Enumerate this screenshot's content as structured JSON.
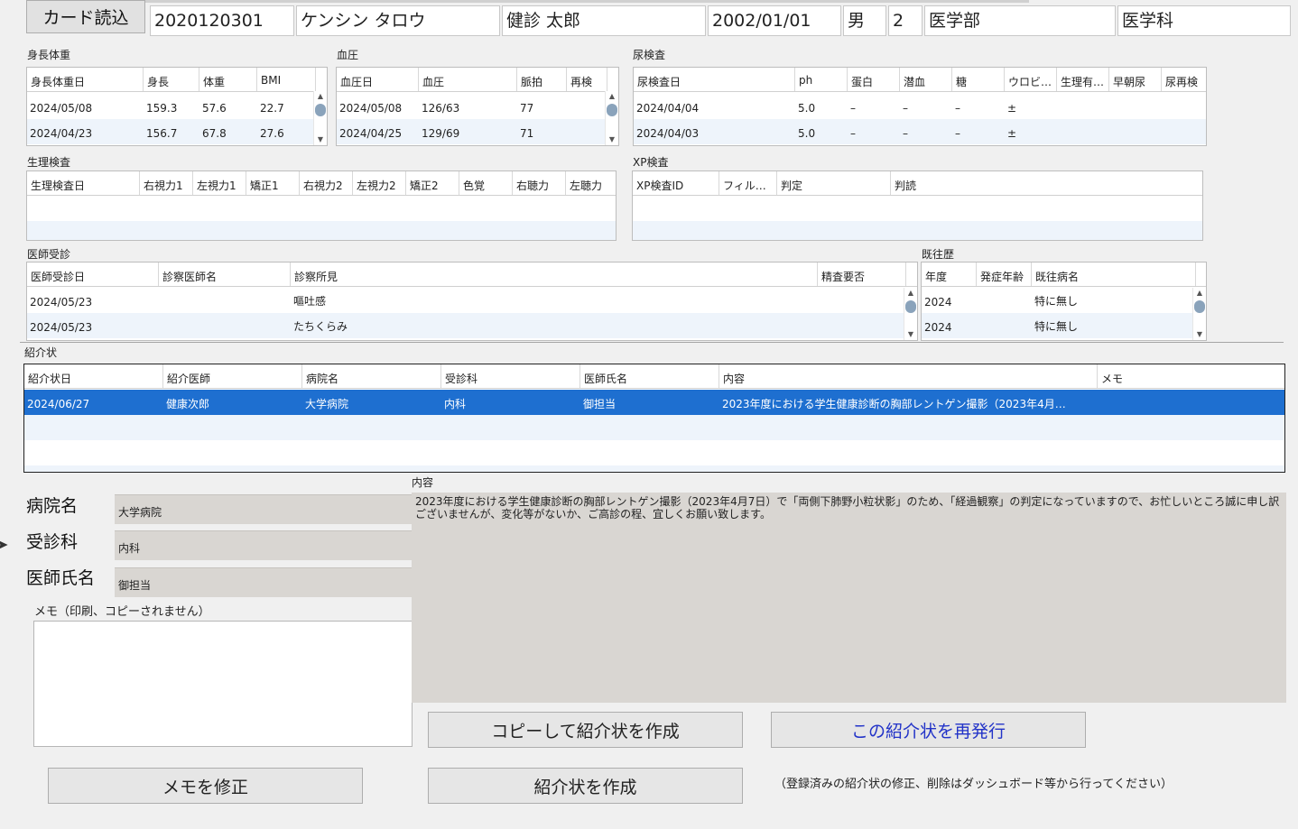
{
  "header": {
    "card_button": "カード読込",
    "student_id": "2020120301",
    "name_kana": "ケンシン タロウ",
    "name": "健診 太郎",
    "birthdate": "2002/01/01",
    "sex": "男",
    "grade": "2",
    "faculty": "医学部",
    "department": "医学科"
  },
  "height_weight": {
    "label": "身長体重",
    "columns": [
      "身長体重日",
      "身長",
      "体重",
      "BMI"
    ],
    "rows": [
      [
        "2024/05/08",
        "159.3",
        "57.6",
        "22.7"
      ],
      [
        "2024/04/23",
        "156.7",
        "67.8",
        "27.6"
      ]
    ]
  },
  "blood_pressure": {
    "label": "血圧",
    "columns": [
      "血圧日",
      "血圧",
      "脈拍",
      "再検"
    ],
    "rows": [
      [
        "2024/05/08",
        "126/63",
        "77",
        ""
      ],
      [
        "2024/04/25",
        "129/69",
        "71",
        ""
      ]
    ]
  },
  "urine": {
    "label": "尿検査",
    "columns": [
      "尿検査日",
      "ph",
      "蛋白",
      "潜血",
      "糖",
      "ウロビ…",
      "生理有…",
      "早朝尿",
      "尿再検"
    ],
    "rows": [
      [
        "2024/04/04",
        "5.0",
        "–",
        "–",
        "–",
        "±",
        "",
        "",
        ""
      ],
      [
        "2024/04/03",
        "5.0",
        "–",
        "–",
        "–",
        "±",
        "",
        "",
        ""
      ]
    ]
  },
  "physio": {
    "label": "生理検査",
    "columns": [
      "生理検査日",
      "右視力1",
      "左視力1",
      "矯正1",
      "右視力2",
      "左視力2",
      "矯正2",
      "色覚",
      "右聴力",
      "左聴力"
    ]
  },
  "xp": {
    "label": "XP検査",
    "columns": [
      "XP検査ID",
      "フィル…",
      "判定",
      "判読"
    ]
  },
  "doctor": {
    "label": "医師受診",
    "columns": [
      "医師受診日",
      "診察医師名",
      "診察所見",
      "精査要否"
    ],
    "rows": [
      [
        "2024/05/23",
        "",
        "嘔吐感",
        ""
      ],
      [
        "2024/05/23",
        "",
        "たちくらみ",
        ""
      ]
    ]
  },
  "history": {
    "label": "既往歴",
    "columns": [
      "年度",
      "発症年齢",
      "既往病名"
    ],
    "rows": [
      [
        "2024",
        "",
        "特に無し"
      ],
      [
        "2024",
        "",
        "特に無し"
      ]
    ]
  },
  "referral": {
    "label": "紹介状",
    "columns": [
      "紹介状日",
      "紹介医師",
      "病院名",
      "受診科",
      "医師氏名",
      "内容",
      "メモ"
    ],
    "rows": [
      [
        "2024/06/27",
        "健康次郎",
        "大学病院",
        "内科",
        "御担当",
        "2023年度における学生健康診断の胸部レントゲン撮影（2023年4月…",
        ""
      ]
    ]
  },
  "detail": {
    "hospital_label": "病院名",
    "hospital_value": "大学病院",
    "dept_label": "受診科",
    "dept_value": "内科",
    "doctor_label": "医師氏名",
    "doctor_value": "御担当",
    "content_label": "内容",
    "content_value": "2023年度における学生健康診断の胸部レントゲン撮影（2023年4月7日）で「両側下肺野小粒状影」のため、「経過観察」の判定になっていますので、お忙しいところ誠に申し訳ございませんが、変化等がないか、ご高診の程、宜しくお願い致します。",
    "memo_label": "メモ（印刷、コピーされません）",
    "memo_value": ""
  },
  "buttons": {
    "copy_create": "コピーして紹介状を作成",
    "reissue": "この紹介状を再発行",
    "edit_memo": "メモを修正",
    "create": "紹介状を作成"
  },
  "note": "（登録済みの紹介状の修正、削除はダッシュボード等から行ってください）",
  "colors": {
    "selected_row": "#1e6fd0",
    "alt_row": "#eef4fb",
    "readonly_field": "#d9d6d2",
    "reissue_text": "#2233c8"
  }
}
